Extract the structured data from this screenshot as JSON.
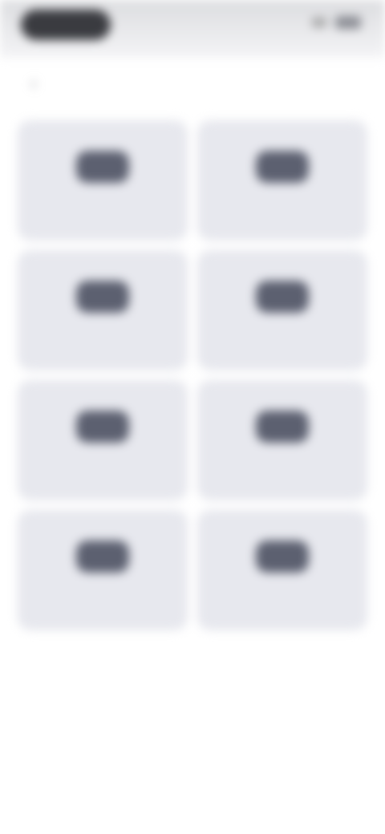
{
  "status_bar": {
    "time": "",
    "signal_icon": "signal-icon",
    "battery_icon": "battery-icon"
  },
  "header": {
    "title": "",
    "back_icon": "back-icon"
  },
  "tiles": [
    {
      "label": "",
      "icon": "tile-icon"
    },
    {
      "label": "",
      "icon": "tile-icon"
    },
    {
      "label": "",
      "icon": "tile-icon"
    },
    {
      "label": "",
      "icon": "tile-icon"
    },
    {
      "label": "",
      "icon": "tile-icon"
    },
    {
      "label": "",
      "icon": "tile-icon"
    },
    {
      "label": "",
      "icon": "tile-icon"
    },
    {
      "label": "",
      "icon": "tile-icon"
    }
  ],
  "colors": {
    "tile_background": "#e7e8ee",
    "icon_color": "#5c6070",
    "status_pill": "#3a3b40"
  }
}
